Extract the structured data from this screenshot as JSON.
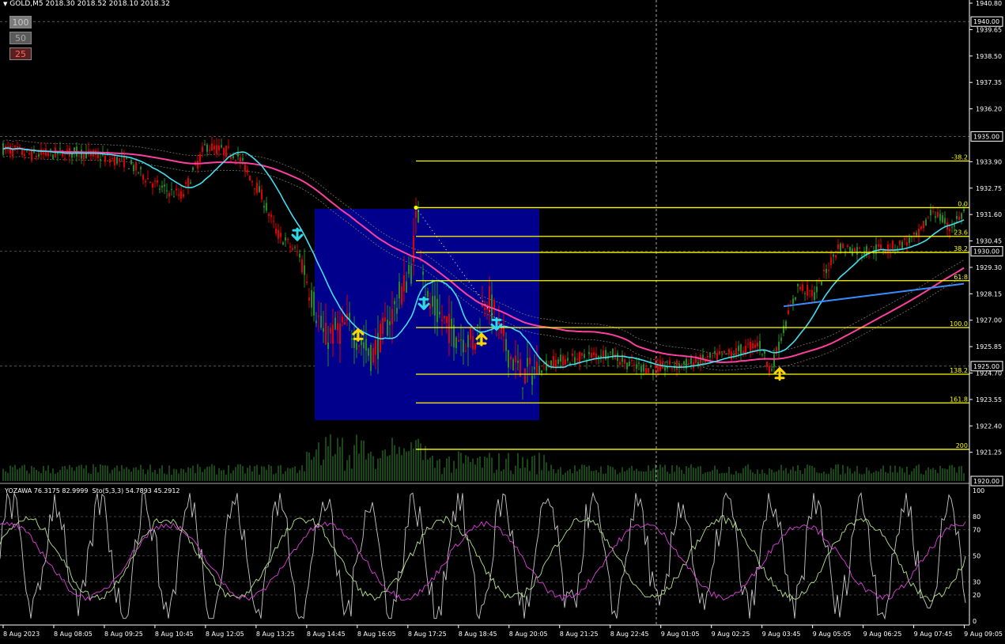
{
  "header": {
    "symbol": "GOLD,M5",
    "ohlc": "2018.30 2018.52 2018.10 2018.32"
  },
  "buttons": [
    {
      "label": "100",
      "bg": "#7a7a7a",
      "color": "#c8c8c8"
    },
    {
      "label": "50",
      "bg": "#5a5a5a",
      "color": "#a8a8a8"
    },
    {
      "label": "25",
      "bg": "#5a2020",
      "color": "#ff6a6a"
    }
  ],
  "price_axis": {
    "min": 1920.0,
    "max": 1940.8,
    "ticks": [
      "1940.80",
      "1939.65",
      "1938.50",
      "1937.35",
      "1936.20",
      "1933.90",
      "1932.75",
      "1931.60",
      "1930.45",
      "1929.30",
      "1928.15",
      "1927.00",
      "1925.85",
      "1924.70",
      "1923.55",
      "1922.40",
      "1921.25"
    ],
    "tick_values": [
      1940.8,
      1939.65,
      1938.5,
      1937.35,
      1936.2,
      1933.9,
      1932.75,
      1931.6,
      1930.45,
      1929.3,
      1928.15,
      1927.0,
      1925.85,
      1924.7,
      1923.55,
      1922.4,
      1921.25
    ],
    "boxed": [
      {
        "label": "1940.00",
        "value": 1940.0
      },
      {
        "label": "1935.00",
        "value": 1935.0
      },
      {
        "label": "1930.00",
        "value": 1930.0
      },
      {
        "label": "1925.00",
        "value": 1925.0
      },
      {
        "label": "1920.00",
        "value": 1920.0
      }
    ]
  },
  "time_axis": [
    "8 Aug 2023",
    "8 Aug 08:05",
    "8 Aug 09:25",
    "8 Aug 10:45",
    "8 Aug 12:05",
    "8 Aug 13:25",
    "8 Aug 14:45",
    "8 Aug 16:05",
    "8 Aug 17:25",
    "8 Aug 18:45",
    "8 Aug 20:05",
    "8 Aug 21:25",
    "8 Aug 22:45",
    "9 Aug 01:05",
    "9 Aug 02:25",
    "9 Aug 03:45",
    "9 Aug 05:05",
    "9 Aug 06:25",
    "9 Aug 07:45",
    "9 Aug 09:05"
  ],
  "fibonacci": {
    "color": "#ffff00",
    "levels": [
      {
        "label": "-38.2",
        "price": 1933.93
      },
      {
        "label": "0.0",
        "price": 1931.9
      },
      {
        "label": "23.6",
        "price": 1930.65
      },
      {
        "label": "38.2",
        "price": 1929.95
      },
      {
        "label": "61.8",
        "price": 1928.72
      },
      {
        "label": "100.0",
        "price": 1926.68
      },
      {
        "label": "138.2",
        "price": 1924.65
      },
      {
        "label": "161.8",
        "price": 1923.4
      },
      {
        "label": "200",
        "price": 1921.38
      }
    ]
  },
  "oscillator": {
    "title": "YOZAWA 76.3175 82.9999  Sto(5,3,3) 54.7893 45.2912",
    "levels": [
      "100",
      "80",
      "70",
      "50",
      "30",
      "20",
      "0"
    ],
    "level_values": [
      100,
      80,
      70,
      50,
      30,
      20,
      0
    ]
  },
  "colors": {
    "bull": "#228b22",
    "bear": "#e00000",
    "ma_fast": "#40e0f0",
    "ma_slow": "#ff3fa0",
    "ma_blue": "#3a8cff",
    "box": "#00008c",
    "volume": "#2f8f2f"
  }
}
